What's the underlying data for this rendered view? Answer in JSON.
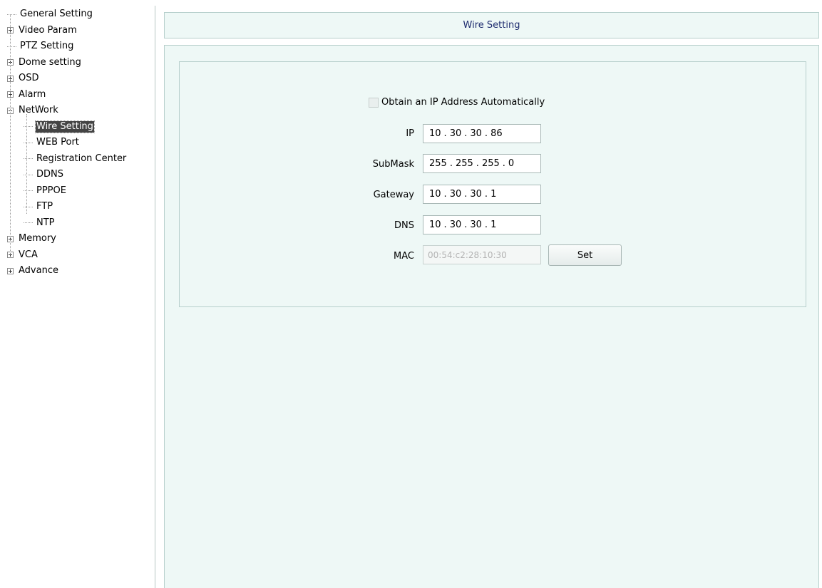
{
  "tree": {
    "items": [
      {
        "label": "General Setting",
        "expander": "none",
        "level": 0
      },
      {
        "label": "Video Param",
        "expander": "plus",
        "level": 0
      },
      {
        "label": "PTZ Setting",
        "expander": "none",
        "level": 0
      },
      {
        "label": "Dome setting",
        "expander": "plus",
        "level": 0
      },
      {
        "label": "OSD",
        "expander": "plus",
        "level": 0
      },
      {
        "label": "Alarm",
        "expander": "plus",
        "level": 0
      },
      {
        "label": "NetWork",
        "expander": "minus",
        "level": 0
      },
      {
        "label": "Wire Setting",
        "expander": "none",
        "level": 1,
        "selected": true
      },
      {
        "label": "WEB Port",
        "expander": "none",
        "level": 1
      },
      {
        "label": "Registration Center",
        "expander": "none",
        "level": 1
      },
      {
        "label": "DDNS",
        "expander": "none",
        "level": 1
      },
      {
        "label": "PPPOE",
        "expander": "none",
        "level": 1
      },
      {
        "label": "FTP",
        "expander": "none",
        "level": 1
      },
      {
        "label": "NTP",
        "expander": "none",
        "level": 1
      },
      {
        "label": "Memory",
        "expander": "plus",
        "level": 0
      },
      {
        "label": "VCA",
        "expander": "plus",
        "level": 0
      },
      {
        "label": "Advance",
        "expander": "plus",
        "level": 0
      }
    ]
  },
  "header": {
    "title": "Wire Setting"
  },
  "form": {
    "auto_ip_label": "Obtain an IP Address Automatically",
    "auto_ip_checked": false,
    "ip": {
      "label": "IP",
      "octets": [
        "10",
        "30",
        "30",
        "86"
      ]
    },
    "submask": {
      "label": "SubMask",
      "octets": [
        "255",
        "255",
        "255",
        "0"
      ]
    },
    "gateway": {
      "label": "Gateway",
      "octets": [
        "10",
        "30",
        "30",
        "1"
      ]
    },
    "dns": {
      "label": "DNS",
      "octets": [
        "10",
        "30",
        "30",
        "1"
      ]
    },
    "mac": {
      "label": "MAC",
      "value": "00:54:c2:28:10:30"
    },
    "set_label": "Set"
  },
  "colors": {
    "panel_bg": "#eef8f6",
    "panel_border": "#b7cfcc",
    "header_text": "#1d2b6e",
    "selection_bg": "#444444"
  }
}
